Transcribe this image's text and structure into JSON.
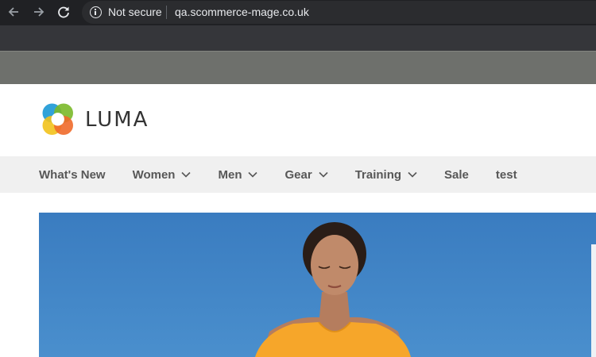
{
  "browser": {
    "security_label": "Not secure",
    "url": "qa.scommerce-mage.co.uk",
    "icons": [
      "back-arrow-icon",
      "forward-arrow-icon",
      "reload-icon",
      "info-icon"
    ]
  },
  "site": {
    "logo_text": "LUMA",
    "nav": [
      {
        "label": "What's New",
        "has_dropdown": false
      },
      {
        "label": "Women",
        "has_dropdown": true
      },
      {
        "label": "Men",
        "has_dropdown": true
      },
      {
        "label": "Gear",
        "has_dropdown": true
      },
      {
        "label": "Training",
        "has_dropdown": true
      },
      {
        "label": "Sale",
        "has_dropdown": false
      },
      {
        "label": "test",
        "has_dropdown": false
      }
    ]
  },
  "colors": {
    "chrome_toolbar": "#202124",
    "chrome_text": "#e8eaed",
    "nav_background": "#f0f0f0",
    "nav_text": "#575757",
    "logo_text": "#333333",
    "hero_sky": "#3f7fbe",
    "hero_shirt": "#f6a62a"
  }
}
